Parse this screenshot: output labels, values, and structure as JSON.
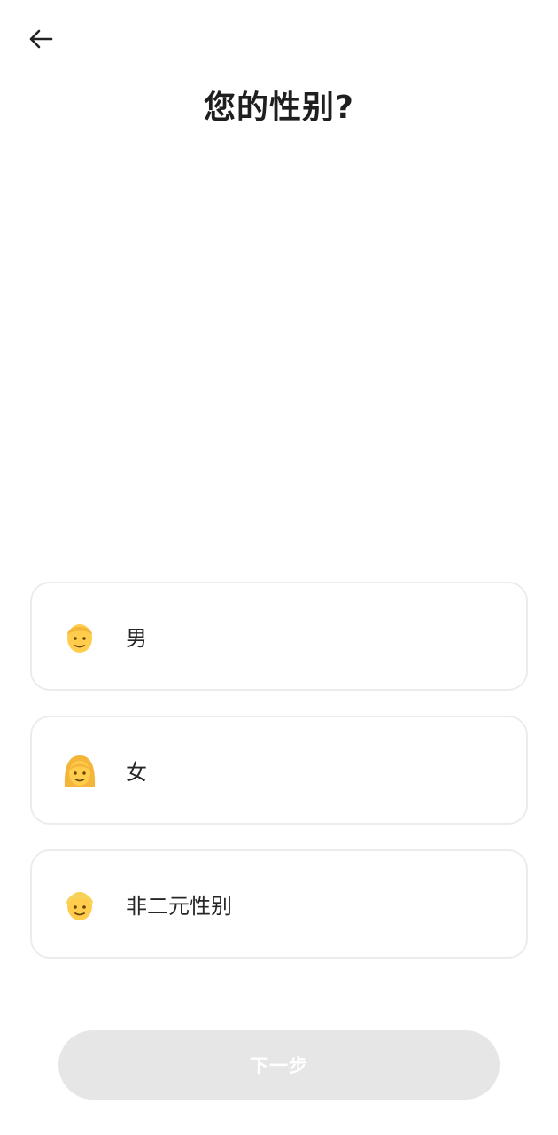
{
  "header": {
    "back_icon": "arrow-left-icon",
    "title": "您的性别?"
  },
  "options": [
    {
      "label": "男",
      "icon": "man-face-icon",
      "hair_color": "#f4b63a"
    },
    {
      "label": "女",
      "icon": "woman-face-icon",
      "hair_color": "#f4b63a"
    },
    {
      "label": "非二元性别",
      "icon": "person-face-icon",
      "hair_color": "#f6d35a"
    }
  ],
  "footer": {
    "next_label": "下一步",
    "next_enabled": false
  },
  "colors": {
    "card_border": "#ececec",
    "button_disabled_bg": "#e6e6e6",
    "skin": "#ffcc4d",
    "text": "#1f1f1f"
  }
}
